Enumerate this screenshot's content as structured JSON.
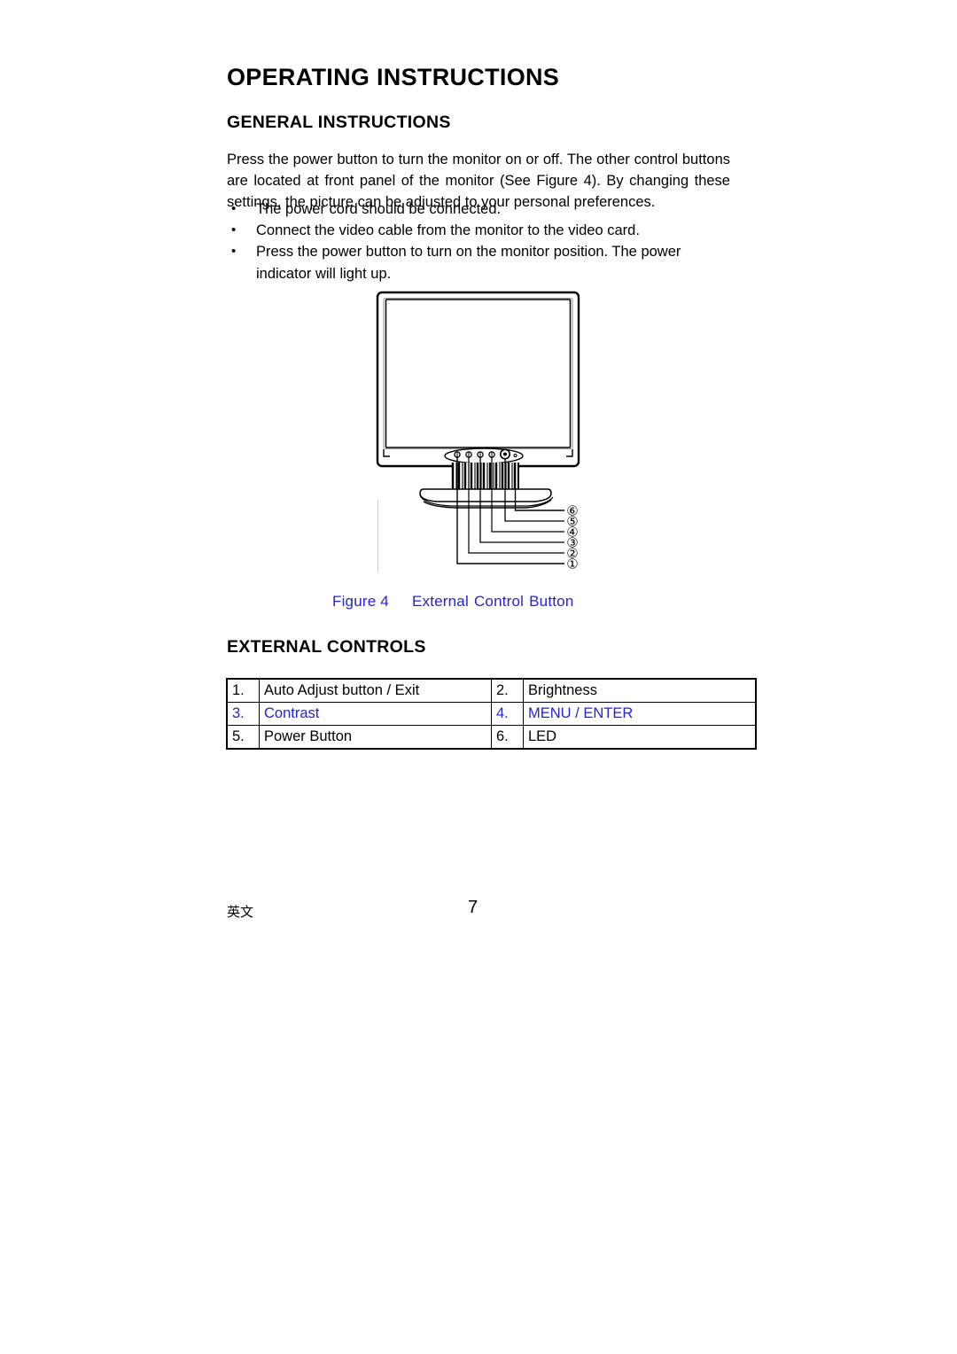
{
  "document": {
    "title": "OPERATING INSTRUCTIONS",
    "sections": {
      "general": {
        "heading": "GENERAL INSTRUCTIONS",
        "paragraph": "Press the power button to turn the monitor on or off. The other control buttons are located at front panel of the monitor (See Figure 4). By changing these settings, the picture can be adjusted to your personal preferences.",
        "bullets": [
          "The power cord should be connected.",
          "Connect the video cable from the monitor to the video card.",
          "Press the power button to turn on the monitor position. The power indicator will light up."
        ],
        "bullet_marker": "•"
      },
      "external_controls": {
        "heading": "EXTERNAL CONTROLS",
        "table": {
          "rows": [
            {
              "blue": false,
              "cells": [
                {
                  "num": "1.",
                  "label": "Auto Adjust button / Exit"
                },
                {
                  "num": "2.",
                  "label": "Brightness"
                }
              ]
            },
            {
              "blue": true,
              "cells": [
                {
                  "num": "3.",
                  "label": "Contrast"
                },
                {
                  "num": "4.",
                  "label": "MENU / ENTER"
                }
              ]
            },
            {
              "blue": false,
              "cells": [
                {
                  "num": "5.",
                  "label": "Power Button"
                },
                {
                  "num": "6.",
                  "label": "LED"
                }
              ]
            }
          ]
        }
      }
    },
    "figure": {
      "caption_label": "Figure 4",
      "caption_word1": "External",
      "caption_word2": "Control",
      "caption_word3": "Button",
      "caption_color": "#2222dd",
      "callouts": [
        {
          "id": "6",
          "glyph": "⑥"
        },
        {
          "id": "5",
          "glyph": "⑤"
        },
        {
          "id": "4",
          "glyph": "④"
        },
        {
          "id": "3",
          "glyph": "③"
        },
        {
          "id": "2",
          "glyph": "②"
        },
        {
          "id": "1",
          "glyph": "①"
        }
      ],
      "alt": "front view of LCD monitor with six numbered external control buttons on the bottom bezel"
    },
    "footer": {
      "left_mark": "英文",
      "page_number": "7"
    }
  }
}
